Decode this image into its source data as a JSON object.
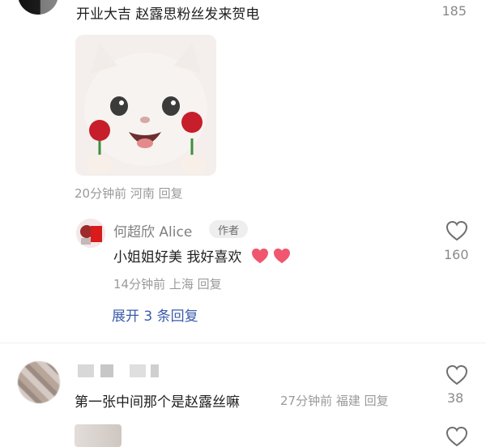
{
  "comments": [
    {
      "text": "开业大吉 赵露思粉丝发来贺电",
      "like_count": "185",
      "sticker": {
        "description": "white-kitten-holding-roses"
      },
      "meta": "20分钟前 河南 回复",
      "replies": [
        {
          "name": "何超欣 Alice",
          "badge": "作者",
          "text": "小姐姐好美 我好喜欢",
          "emoji": [
            "heart",
            "heart"
          ],
          "meta": "14分钟前 上海 回复",
          "like_count": "160"
        }
      ],
      "expand_label": "展开 3 条回复"
    },
    {
      "text": "第一张中间那个是赵露丝嘛",
      "meta": "27分钟前 福建 回复",
      "like_count": "38"
    }
  ],
  "colors": {
    "link": "#3b5bab",
    "muted": "#9a9a9a",
    "heart_emoji": "#f0576f"
  }
}
